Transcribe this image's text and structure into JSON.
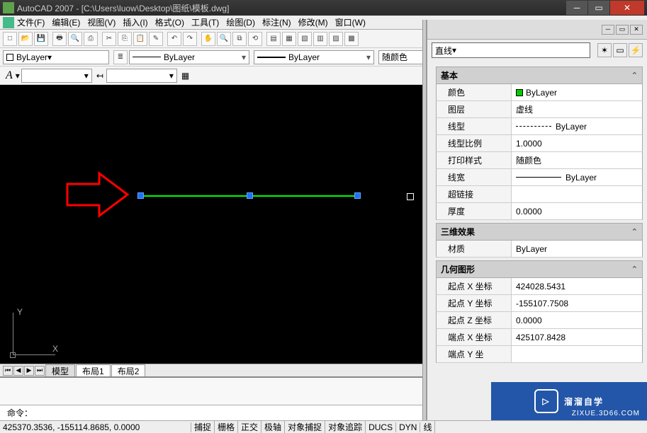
{
  "window": {
    "title": "AutoCAD 2007 - [C:\\Users\\luow\\Desktop\\图纸\\模板.dwg]"
  },
  "menu": {
    "items": [
      "文件(F)",
      "编辑(E)",
      "视图(V)",
      "插入(I)",
      "格式(O)",
      "工具(T)",
      "绘图(D)",
      "标注(N)",
      "修改(M)",
      "窗口(W)"
    ]
  },
  "layers": {
    "current": "ByLayer",
    "linetype": "ByLayer",
    "lineweight": "ByLayer",
    "plotstyle": "随颜色"
  },
  "textstyle": {
    "label": "A"
  },
  "tabs": {
    "items": [
      "模型",
      "布局1",
      "布局2"
    ],
    "active": 0
  },
  "command": {
    "prompt": "命令："
  },
  "status": {
    "coords": "425370.3536, -155114.8685, 0.0000",
    "toggles": [
      "捕捉",
      "栅格",
      "正交",
      "极轴",
      "对象捕捉",
      "对象追踪",
      "DUCS",
      "DYN",
      "线"
    ]
  },
  "properties": {
    "type_selector": "直线",
    "categories": [
      {
        "title": "基本",
        "rows": [
          {
            "name": "颜色",
            "value": "ByLayer",
            "swatch": true
          },
          {
            "name": "图层",
            "value": "虚线"
          },
          {
            "name": "线型",
            "value": "ByLayer",
            "dash": true
          },
          {
            "name": "线型比例",
            "value": "1.0000"
          },
          {
            "name": "打印样式",
            "value": "随颜色"
          },
          {
            "name": "线宽",
            "value": "ByLayer",
            "solid": true
          },
          {
            "name": "超链接",
            "value": ""
          },
          {
            "name": "厚度",
            "value": "0.0000"
          }
        ]
      },
      {
        "title": "三维效果",
        "rows": [
          {
            "name": "材质",
            "value": "ByLayer"
          }
        ]
      },
      {
        "title": "几何图形",
        "rows": [
          {
            "name": "起点 X 坐标",
            "value": "424028.5431"
          },
          {
            "name": "起点 Y 坐标",
            "value": "-155107.7508"
          },
          {
            "name": "起点 Z 坐标",
            "value": "0.0000"
          },
          {
            "name": "端点 X 坐标",
            "value": "425107.8428"
          },
          {
            "name": "端点 Y 坐",
            "value": ""
          }
        ]
      }
    ]
  },
  "watermark": {
    "text": "溜溜自学",
    "url": "ZIXUE.3D66.COM"
  },
  "ucs": {
    "x": "X",
    "y": "Y"
  }
}
